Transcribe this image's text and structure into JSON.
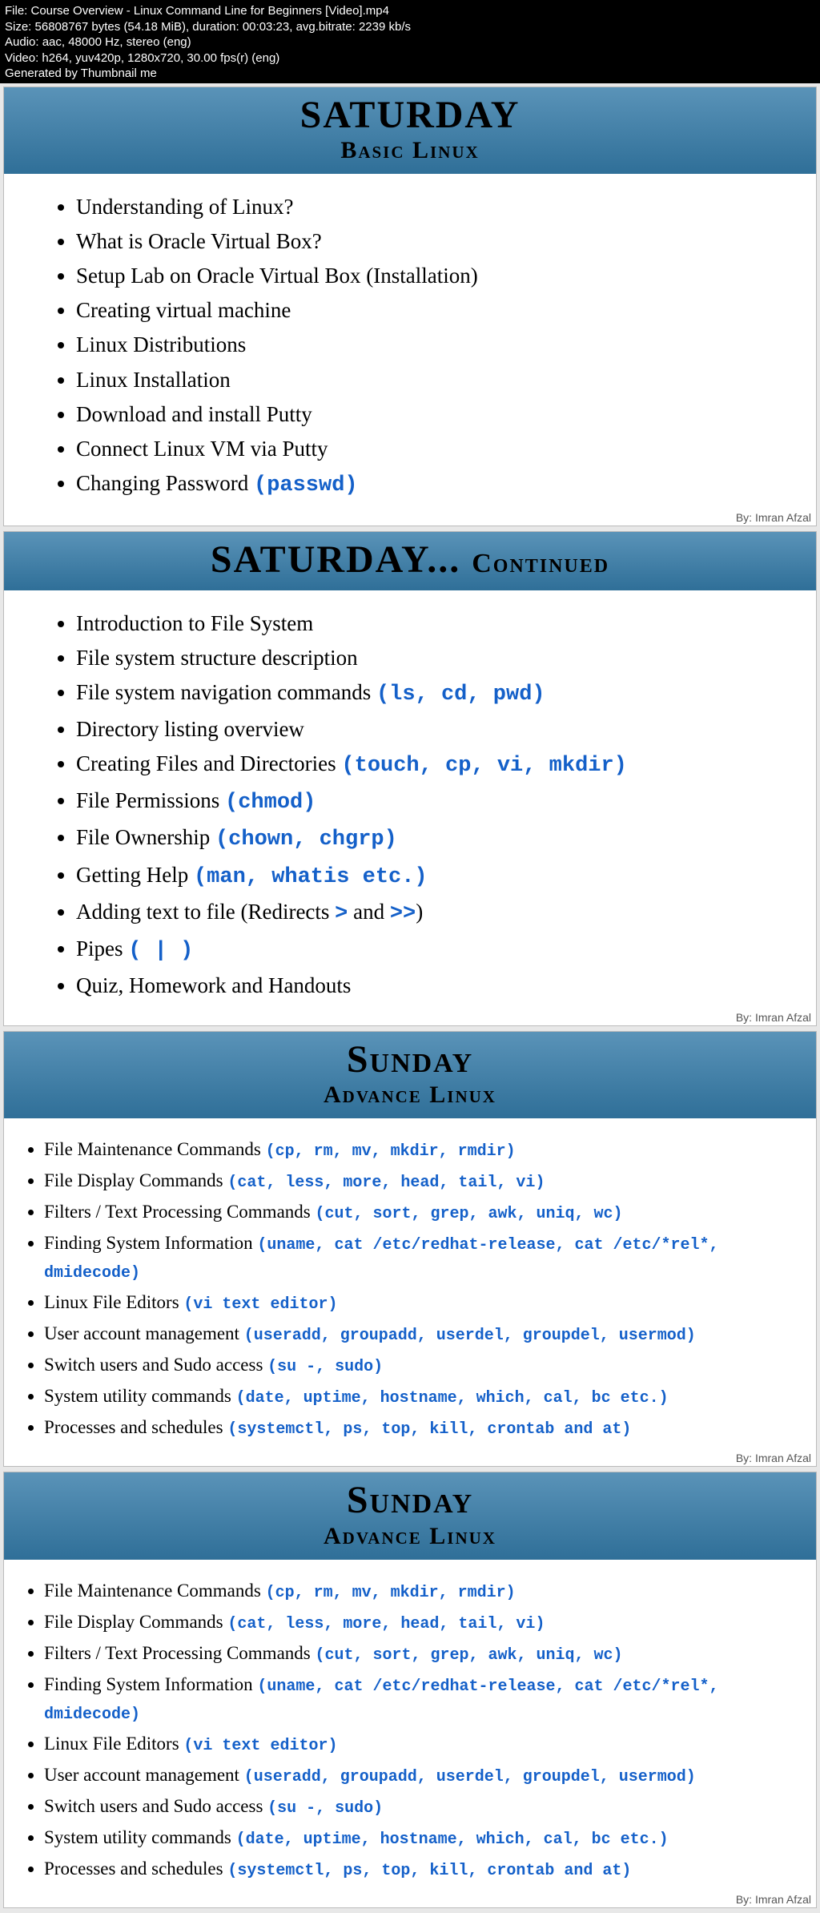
{
  "meta": {
    "fileLine": "File: Course Overview - Linux Command Line for Beginners [Video].mp4",
    "sizeLine": "Size: 56808767 bytes (54.18 MiB), duration: 00:03:23, avg.bitrate: 2239 kb/s",
    "audioLine": "Audio: aac, 48000 Hz, stereo (eng)",
    "videoLine": "Video: h264, yuv420p, 1280x720, 30.00 fps(r) (eng)",
    "genLine": "Generated by Thumbnail me"
  },
  "credit": "By: Imran Afzal",
  "slides": [
    {
      "title": "SATURDAY",
      "subtitle": "Basic Linux",
      "topics": [
        {
          "text": "Understanding of Linux?"
        },
        {
          "text": "What is Oracle Virtual Box?"
        },
        {
          "text": "Setup Lab on Oracle Virtual Box (Installation)"
        },
        {
          "text": "Creating virtual machine"
        },
        {
          "text": "Linux Distributions"
        },
        {
          "text": "Linux Installation"
        },
        {
          "text": "Download and install Putty"
        },
        {
          "text": "Connect Linux VM via Putty"
        },
        {
          "text": "Changing Password ",
          "code": "(passwd)"
        }
      ],
      "size": "large"
    },
    {
      "title": "SATURDAY... ",
      "titleCont": "Continued",
      "topics": [
        {
          "text": "Introduction to File System"
        },
        {
          "text": "File system structure description"
        },
        {
          "text": "File system navigation commands ",
          "code": "(ls, cd, pwd)"
        },
        {
          "text": "Directory listing overview"
        },
        {
          "text": "Creating Files and Directories ",
          "code": "(touch, cp, vi, mkdir)"
        },
        {
          "text": "File Permissions ",
          "code": "(chmod)"
        },
        {
          "text": "File Ownership ",
          "code": "(chown, chgrp)"
        },
        {
          "text": "Getting Help ",
          "code": "(man, whatis etc.)"
        },
        {
          "text": "Adding text to file (Redirects ",
          "code": ">",
          "text2": " and ",
          "code2": ">>",
          "text3": ")"
        },
        {
          "text": "Pipes ",
          "code": "( | )"
        },
        {
          "text": "Quiz, Homework and Handouts"
        }
      ],
      "size": "large"
    },
    {
      "title": "Sunday",
      "subtitle": "Advance Linux",
      "topics": [
        {
          "text": "File Maintenance Commands ",
          "code": "(cp, rm, mv, mkdir, rmdir)"
        },
        {
          "text": "File Display Commands ",
          "code": "(cat, less, more, head, tail, vi)"
        },
        {
          "text": "Filters / Text Processing Commands ",
          "code": "(cut, sort, grep, awk, uniq, wc)"
        },
        {
          "text": "Finding System Information ",
          "code": "(uname, cat /etc/redhat-release, cat /etc/*rel*, dmidecode)"
        },
        {
          "text": "Linux File Editors ",
          "code": "(vi text editor)"
        },
        {
          "text": "User account management ",
          "code": "(useradd, groupadd, userdel, groupdel, usermod)"
        },
        {
          "text": "Switch users and Sudo access ",
          "code": "(su -, sudo)"
        },
        {
          "text": "System utility commands ",
          "code": "(date, uptime, hostname, which, cal, bc etc.)"
        },
        {
          "text": "Processes and schedules ",
          "code": "(systemctl, ps, top, kill, crontab and at)"
        }
      ],
      "size": "small"
    },
    {
      "title": "Sunday",
      "subtitle": "Advance Linux",
      "topics": [
        {
          "text": "File Maintenance Commands ",
          "code": "(cp, rm, mv, mkdir, rmdir)"
        },
        {
          "text": "File Display Commands ",
          "code": "(cat, less, more, head, tail, vi)"
        },
        {
          "text": "Filters / Text Processing Commands ",
          "code": "(cut, sort, grep, awk, uniq, wc)"
        },
        {
          "text": "Finding System Information ",
          "code": "(uname, cat /etc/redhat-release, cat /etc/*rel*, dmidecode)"
        },
        {
          "text": "Linux File Editors ",
          "code": "(vi text editor)"
        },
        {
          "text": "User account management ",
          "code": "(useradd, groupadd, userdel, groupdel, usermod)"
        },
        {
          "text": "Switch users and Sudo access ",
          "code": "(su -, sudo)"
        },
        {
          "text": "System utility commands ",
          "code": "(date, uptime, hostname, which, cal, bc etc.)"
        },
        {
          "text": "Processes and schedules ",
          "code": "(systemctl, ps, top, kill, crontab and at)"
        }
      ],
      "size": "small"
    }
  ]
}
